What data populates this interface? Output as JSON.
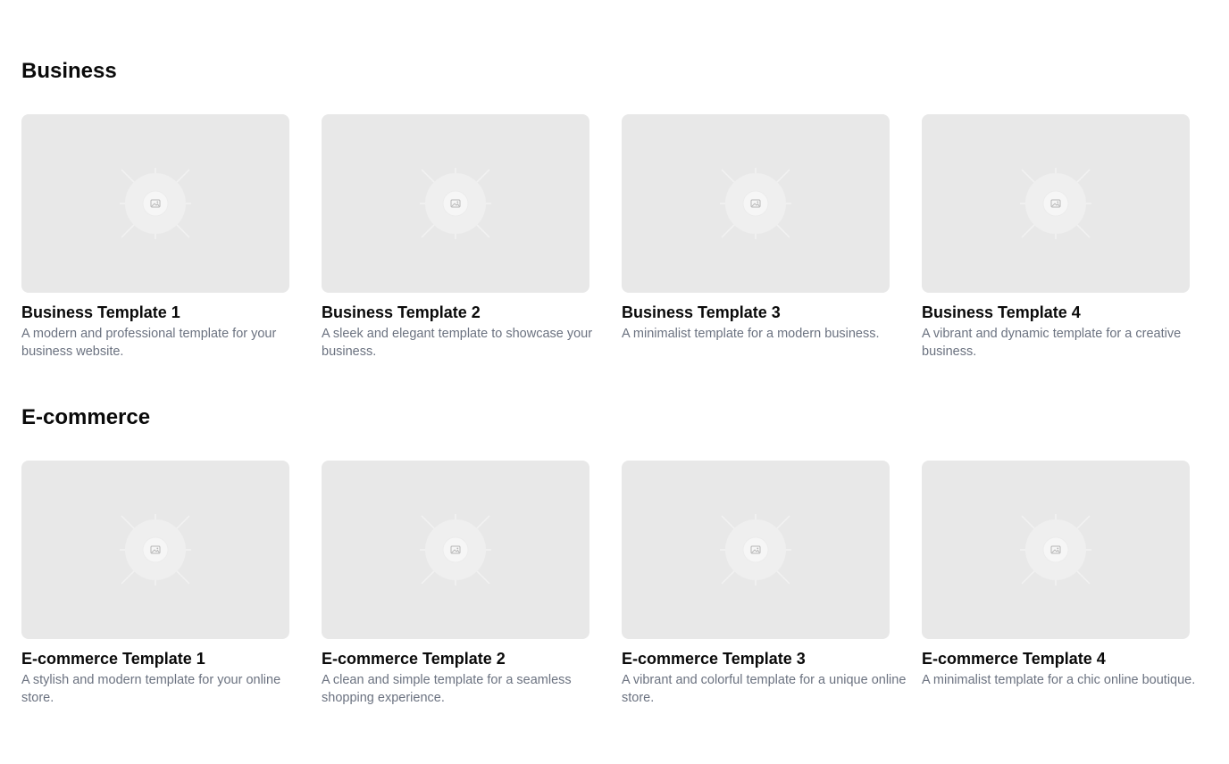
{
  "sections": [
    {
      "title": "Business",
      "templates": [
        {
          "title": "Business Template 1",
          "description": "A modern and professional template for your business website."
        },
        {
          "title": "Business Template 2",
          "description": "A sleek and elegant template to showcase your business."
        },
        {
          "title": "Business Template 3",
          "description": "A minimalist template for a modern business."
        },
        {
          "title": "Business Template 4",
          "description": "A vibrant and dynamic template for a creative business."
        }
      ]
    },
    {
      "title": "E-commerce",
      "templates": [
        {
          "title": "E-commerce Template 1",
          "description": "A stylish and modern template for your online store."
        },
        {
          "title": "E-commerce Template 2",
          "description": "A clean and simple template for a seamless shopping experience."
        },
        {
          "title": "E-commerce Template 3",
          "description": "A vibrant and colorful template for a unique online store."
        },
        {
          "title": "E-commerce Template 4",
          "description": "A minimalist template for a chic online boutique."
        }
      ]
    }
  ],
  "colors": {
    "background": "#ffffff",
    "thumbnail": "#e8e8e8",
    "title": "#0a0a0a",
    "description": "#6b7280"
  },
  "icons": {
    "thumbnail_placeholder": "image-placeholder-icon"
  }
}
